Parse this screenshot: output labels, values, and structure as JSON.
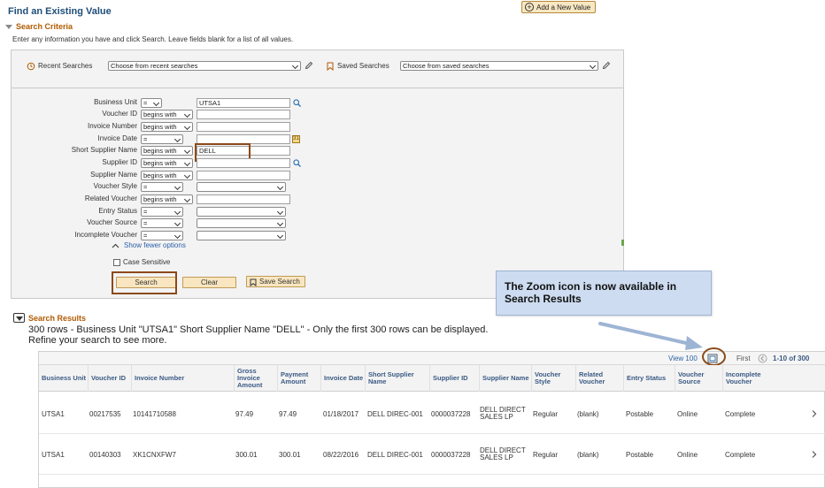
{
  "header": {
    "title": "Find an Existing Value",
    "add_new_label": "Add a New Value"
  },
  "search_criteria": {
    "heading": "Search Criteria",
    "instructions": "Enter any information you have and click Search. Leave fields blank for a list of all values.",
    "recent_searches_label": "Recent Searches",
    "recent_searches_value": "Choose from recent searches",
    "saved_searches_label": "Saved Searches",
    "saved_searches_value": "Choose from saved searches",
    "fields": [
      {
        "label": "Business Unit",
        "operator": "=",
        "value": "UTSA1",
        "lookup": true
      },
      {
        "label": "Voucher ID",
        "operator": "begins with",
        "value": ""
      },
      {
        "label": "Invoice Number",
        "operator": "begins with",
        "value": ""
      },
      {
        "label": "Invoice Date",
        "operator": "=",
        "value": "",
        "calendar": true
      },
      {
        "label": "Short Supplier Name",
        "operator": "begins with",
        "value": "DELL"
      },
      {
        "label": "Supplier ID",
        "operator": "begins with",
        "value": "",
        "lookup": true
      },
      {
        "label": "Supplier Name",
        "operator": "begins with",
        "value": ""
      },
      {
        "label": "Voucher Style",
        "operator": "=",
        "value": ""
      },
      {
        "label": "Related Voucher",
        "operator": "begins with",
        "value": ""
      },
      {
        "label": "Entry Status",
        "operator": "=",
        "value": ""
      },
      {
        "label": "Voucher Source",
        "operator": "=",
        "value": ""
      },
      {
        "label": "Incomplete Voucher",
        "operator": "=",
        "value": ""
      }
    ],
    "show_fewer_label": "Show fewer options",
    "case_sensitive_label": "Case Sensitive",
    "search_button": "Search",
    "clear_button": "Clear",
    "save_search_button": "Save Search"
  },
  "callout": {
    "text": "The Zoom icon is now available in Search Results"
  },
  "search_results": {
    "heading": "Search Results",
    "message": "300 rows  -   Business Unit \"UTSA1\"   Short Supplier Name \"DELL\" - Only the first 300 rows can be displayed. Refine your search to see more.",
    "view_100": "View 100",
    "first_label": "First",
    "range_label": "1-10 of 300",
    "columns": [
      "Business Unit",
      "Voucher ID",
      "Invoice Number",
      "Gross Invoice Amount",
      "Payment Amount",
      "Invoice Date",
      "Short Supplier Name",
      "Supplier ID",
      "Supplier Name",
      "Voucher Style",
      "Related Voucher",
      "Entry Status",
      "Voucher Source",
      "Incomplete Voucher"
    ],
    "rows": [
      [
        "UTSA1",
        "00217535",
        "10141710588",
        "97.49",
        "97.49",
        "01/18/2017",
        "DELL DIREC-001",
        "0000037228",
        "DELL DIRECT SALES LP",
        "Regular",
        "(blank)",
        "Postable",
        "Online",
        "Complete"
      ],
      [
        "UTSA1",
        "00140303",
        "XK1CNXFW7",
        "300.01",
        "300.01",
        "08/22/2016",
        "DELL DIREC-001",
        "0000037228",
        "DELL DIRECT SALES LP",
        "Regular",
        "(blank)",
        "Postable",
        "Online",
        "Complete"
      ]
    ]
  },
  "colors": {
    "title_blue": "#1f4e79",
    "section_orange": "#b05a00",
    "highlight_brown": "#8b4a1a",
    "callout_bg": "#cddcf0",
    "button_bg": "#f9e6c0"
  }
}
